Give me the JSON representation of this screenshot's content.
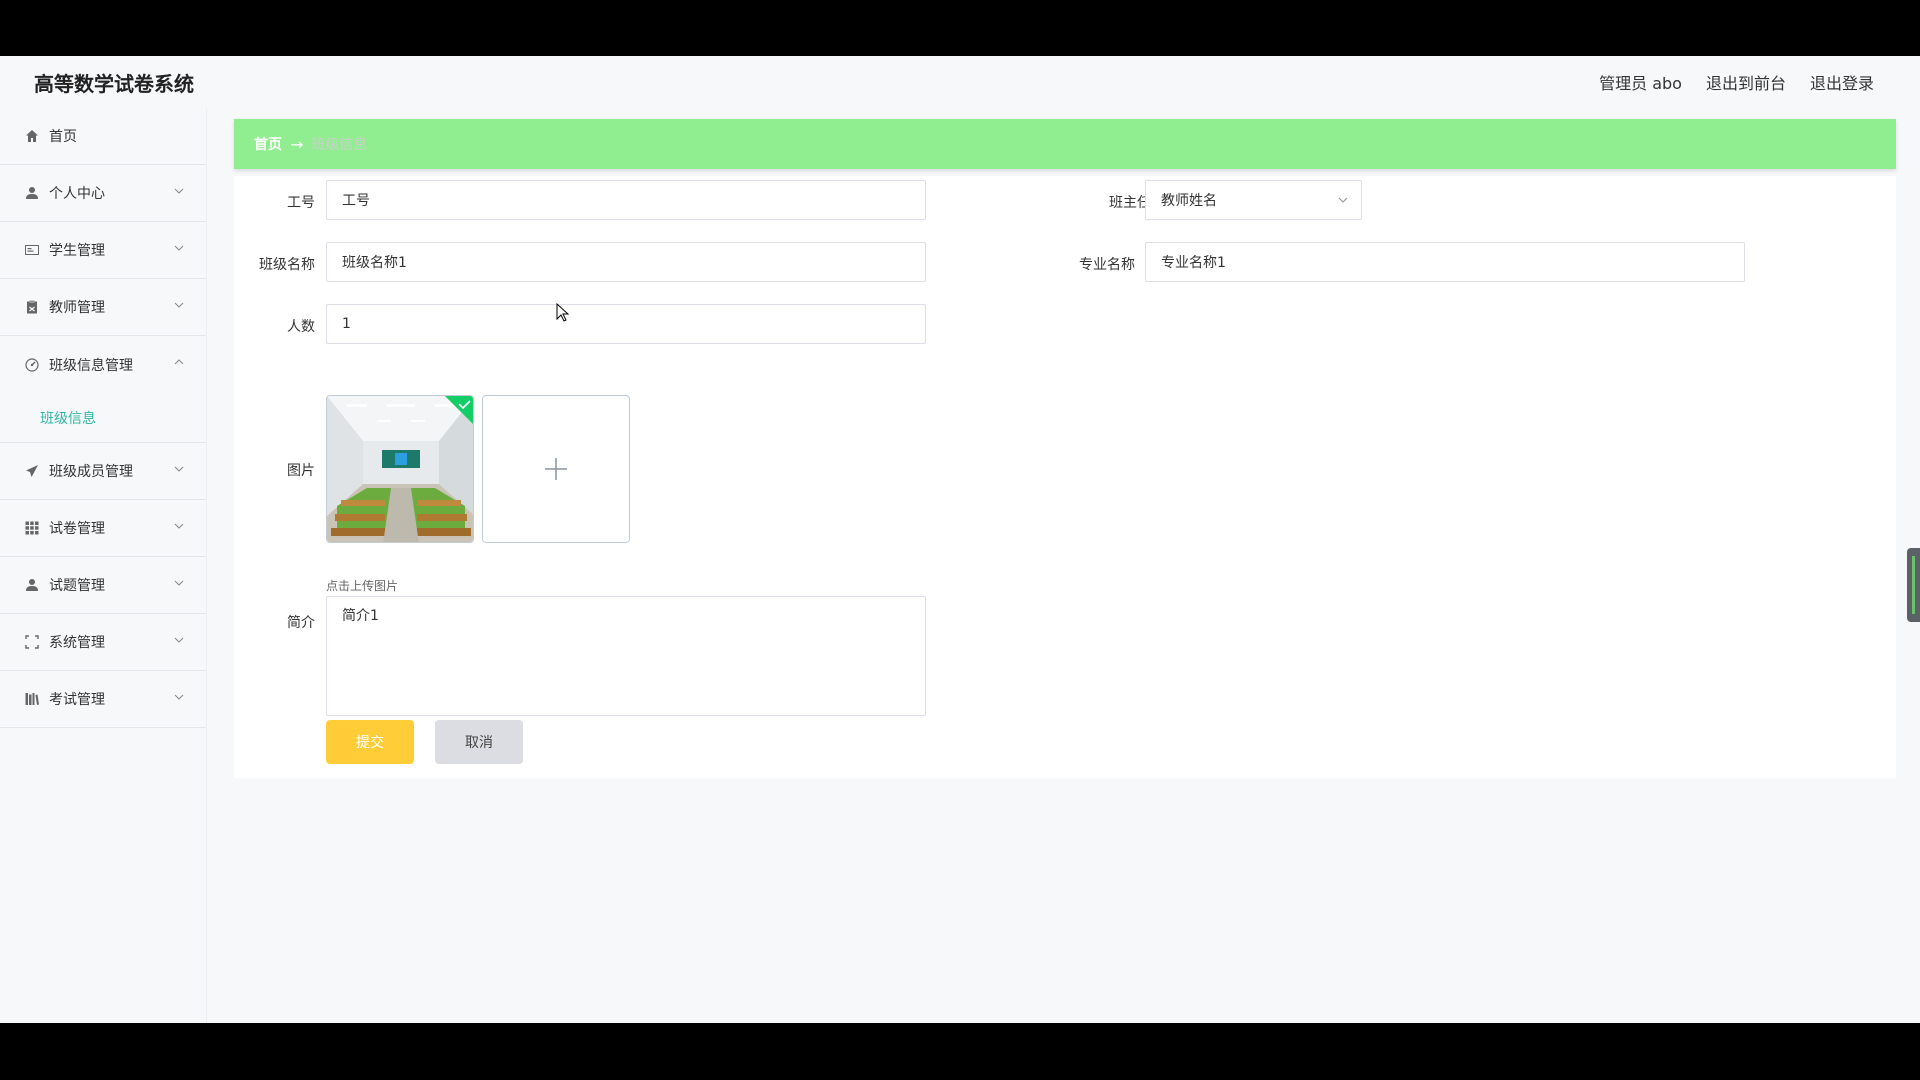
{
  "header": {
    "title": "高等数学试卷系统",
    "user": "管理员 abo",
    "to_front": "退出到前台",
    "logout": "退出登录"
  },
  "sidebar": {
    "items": [
      {
        "label": "首页",
        "icon": "home-icon"
      },
      {
        "label": "个人中心",
        "icon": "user-icon"
      },
      {
        "label": "学生管理",
        "icon": "id-card-icon"
      },
      {
        "label": "教师管理",
        "icon": "clipboard-icon"
      },
      {
        "label": "班级信息管理",
        "icon": "gauge-icon"
      },
      {
        "label": "班级成员管理",
        "icon": "paper-plane-icon"
      },
      {
        "label": "试卷管理",
        "icon": "grid-icon"
      },
      {
        "label": "试题管理",
        "icon": "user-icon"
      },
      {
        "label": "系统管理",
        "icon": "expand-icon"
      },
      {
        "label": "考试管理",
        "icon": "books-icon"
      }
    ],
    "submenu_active": "班级信息"
  },
  "breadcrumb": {
    "home": "首页",
    "separator": "→",
    "current": "班级信息"
  },
  "form": {
    "gonghao_label": "工号",
    "gonghao_placeholder": "工号",
    "banzhuren_label": "班主任",
    "banzhuren_value": "教师姓名",
    "class_name_label": "班级名称",
    "class_name_value": "班级名称1",
    "major_label": "专业名称",
    "major_value": "专业名称1",
    "count_label": "人数",
    "count_value": "1",
    "image_label": "图片",
    "upload_tip": "点击上传图片",
    "intro_label": "简介",
    "intro_value": "简介1",
    "submit": "提交",
    "cancel": "取消"
  },
  "colors": {
    "breadcrumb_bg": "#90ee90",
    "active_submenu": "#2fb8a6",
    "submit_bg": "#ffcd38",
    "cancel_bg": "#dcdde2"
  }
}
